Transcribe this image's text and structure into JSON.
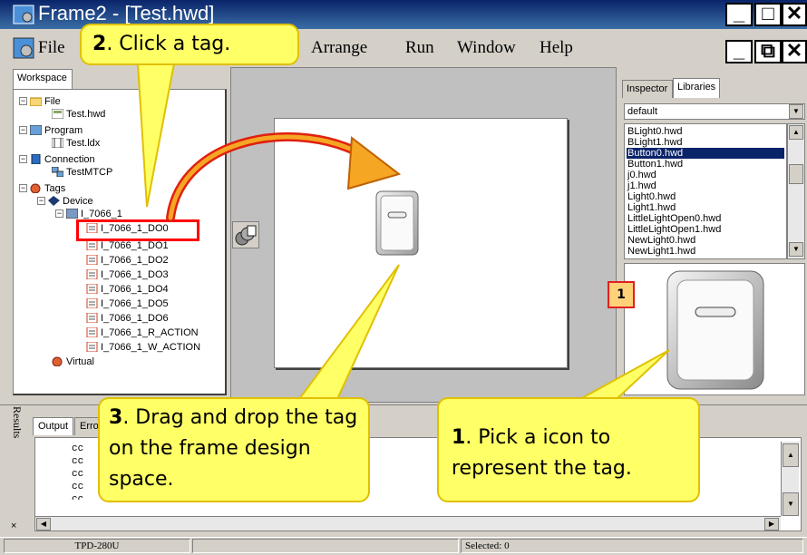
{
  "window": {
    "title": "Frame2 - [Test.hwd]",
    "controls": {
      "minimize": "_",
      "maximize": "□",
      "close": "✕",
      "restore": "⧉"
    }
  },
  "menu": [
    {
      "label": "File"
    },
    {
      "label": "Arrange"
    },
    {
      "label": "Run"
    },
    {
      "label": "Window"
    },
    {
      "label": "Help"
    }
  ],
  "workspace": {
    "tab": "Workspace",
    "tree": [
      {
        "label": "File",
        "icon": "folder-icon"
      },
      {
        "label": "Test.hwd",
        "icon": "frame-file-icon"
      },
      {
        "label": "Program",
        "icon": "program-icon"
      },
      {
        "label": "Test.ldx",
        "icon": "ladder-file-icon"
      },
      {
        "label": "Connection",
        "icon": "connection-icon"
      },
      {
        "label": "TestMTCP",
        "icon": "network-icon"
      },
      {
        "label": "Tags",
        "icon": "tags-icon"
      },
      {
        "label": "Device",
        "icon": "device-icon"
      },
      {
        "label": "I_7066_1",
        "icon": "module-icon"
      },
      {
        "label": "I_7066_1_DO0",
        "icon": "tag-icon"
      },
      {
        "label": "I_7066_1_DO1",
        "icon": "tag-icon"
      },
      {
        "label": "I_7066_1_DO2",
        "icon": "tag-icon"
      },
      {
        "label": "I_7066_1_DO3",
        "icon": "tag-icon"
      },
      {
        "label": "I_7066_1_DO4",
        "icon": "tag-icon"
      },
      {
        "label": "I_7066_1_DO5",
        "icon": "tag-icon"
      },
      {
        "label": "I_7066_1_DO6",
        "icon": "tag-icon"
      },
      {
        "label": "I_7066_1_R_ACTION",
        "icon": "tag-icon"
      },
      {
        "label": "I_7066_1_W_ACTION",
        "icon": "tag-icon"
      },
      {
        "label": "Virtual",
        "icon": "virtual-icon"
      }
    ]
  },
  "inspector": {
    "tabs": [
      {
        "label": "Inspector"
      },
      {
        "label": "Libraries"
      }
    ],
    "library_select": "default",
    "library_items": [
      "BLight0.hwd",
      "BLight1.hwd",
      "Button0.hwd",
      "Button1.hwd",
      "j0.hwd",
      "j1.hwd",
      "Light0.hwd",
      "Light1.hwd",
      "LittleLightOpen0.hwd",
      "LittleLightOpen1.hwd",
      "NewLight0.hwd",
      "NewLight1.hwd"
    ],
    "selected_item": "Button0.hwd"
  },
  "results": {
    "label": "Results",
    "close": "×",
    "tabs": [
      {
        "label": "Output"
      },
      {
        "label": "Erro"
      }
    ],
    "lines": [
      "cc",
      "cc",
      "cc",
      "cc",
      "cc"
    ]
  },
  "status": {
    "left": "TPD-280U",
    "right": "Selected: 0"
  },
  "callouts": {
    "step1": {
      "num": "1",
      "text": ".  Pick a icon to represent the tag."
    },
    "step2": {
      "num": "2",
      "text": ".  Click a tag."
    },
    "step3": {
      "num": "3",
      "text": ".  Drag and drop the tag on the frame design space."
    },
    "badge": "1"
  },
  "colors": {
    "titlebar": "#0a246a",
    "selection": "#0a246a",
    "callout_fill": "#ffff66",
    "callout_border": "#e0c000",
    "highlight": "#ff0000",
    "arrow_orange": "#f5a623"
  }
}
